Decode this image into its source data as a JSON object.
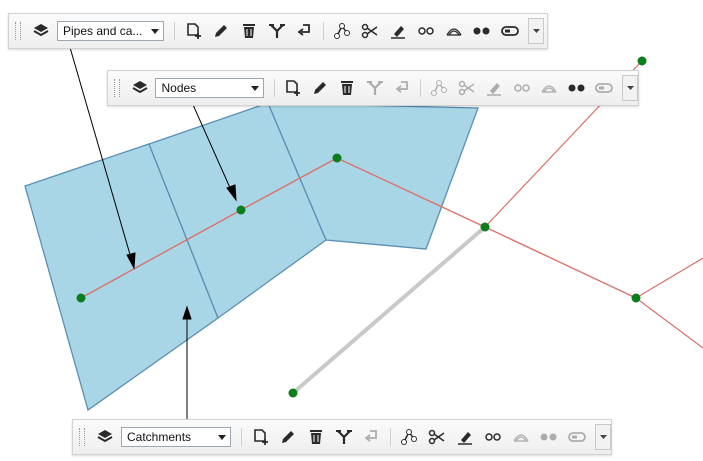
{
  "toolbars": {
    "pipes": {
      "layer_selected": "Pipes and ca..."
    },
    "nodes": {
      "layer_selected": "Nodes"
    },
    "catchments": {
      "layer_selected": "Catchments"
    }
  },
  "colors": {
    "catchment_fill": "#a8d6e6",
    "catchment_border": "#5b8fb3",
    "pipe": "#d9726a",
    "pipe_highlight": "#c9c9c9",
    "node": "#0b7d1a",
    "icon": "#2a2a2a"
  },
  "icons": [
    "layers-icon",
    "add-feature-icon",
    "edit-icon",
    "delete-icon",
    "split-icon",
    "undo-icon",
    "vertex-icon",
    "cut-icon",
    "erase-icon",
    "link-icon",
    "fillet-icon",
    "nodes-icon",
    "toggle-icon"
  ]
}
